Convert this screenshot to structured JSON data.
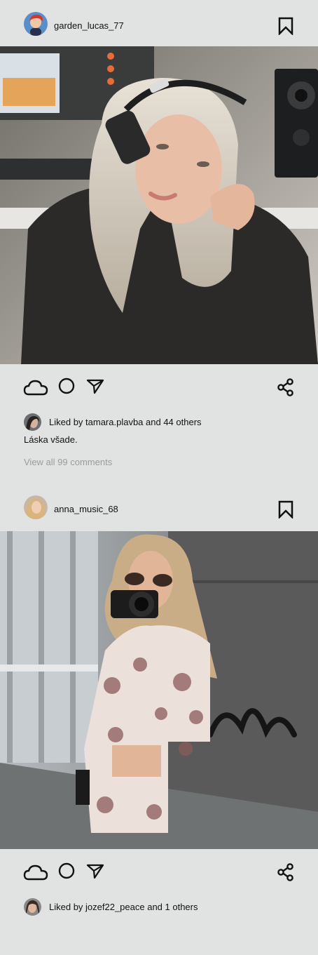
{
  "posts": [
    {
      "username": "garden_lucas_77",
      "liked_by": "Liked by tamara.plavba and 44 others",
      "caption": "Láska všade.",
      "comments_link": "View all 99 comments"
    },
    {
      "username": "anna_music_68",
      "liked_by": "Liked by jozef22_peace and 1 others"
    }
  ],
  "icons": {
    "like": "cloud-icon",
    "comment": "circle-icon",
    "send": "send-icon",
    "share": "share-icon",
    "save": "bookmark-icon"
  }
}
